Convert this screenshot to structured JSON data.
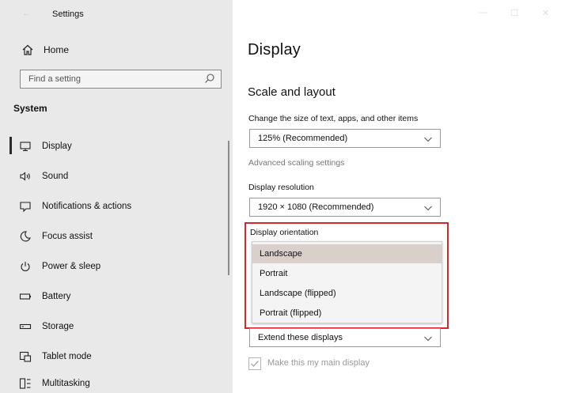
{
  "window": {
    "title": "Settings",
    "controls": [
      "minimize",
      "maximize",
      "close"
    ]
  },
  "sidebar": {
    "home_label": "Home",
    "search_placeholder": "Find a setting",
    "section_title": "System",
    "items": [
      {
        "label": "Display",
        "icon": "monitor-icon",
        "active": true
      },
      {
        "label": "Sound",
        "icon": "speaker-icon",
        "active": false
      },
      {
        "label": "Notifications & actions",
        "icon": "notification-icon",
        "active": false
      },
      {
        "label": "Focus assist",
        "icon": "moon-icon",
        "active": false
      },
      {
        "label": "Power & sleep",
        "icon": "power-icon",
        "active": false
      },
      {
        "label": "Battery",
        "icon": "battery-icon",
        "active": false
      },
      {
        "label": "Storage",
        "icon": "storage-icon",
        "active": false
      },
      {
        "label": "Tablet mode",
        "icon": "tablet-mode-icon",
        "active": false
      },
      {
        "label": "Multitasking",
        "icon": "multitasking-icon",
        "active": false
      }
    ]
  },
  "main": {
    "page_title": "Display",
    "section_title": "Scale and layout",
    "scale": {
      "label": "Change the size of text, apps, and other items",
      "value": "125% (Recommended)"
    },
    "advanced_link": "Advanced scaling settings",
    "resolution": {
      "label": "Display resolution",
      "value": "1920 × 1080 (Recommended)"
    },
    "orientation": {
      "label": "Display orientation",
      "options": [
        "Landscape",
        "Portrait",
        "Landscape (flipped)",
        "Portrait (flipped)"
      ],
      "selected": "Landscape"
    },
    "multiple_displays": {
      "value": "Extend these displays"
    },
    "main_display_checkbox": {
      "label": "Make this my main display",
      "checked": true,
      "disabled": true
    }
  },
  "colors": {
    "sidebar_bg": "#e9e9e9",
    "highlight_border": "#d7262e",
    "selected_option_bg": "#d9d0cc"
  }
}
